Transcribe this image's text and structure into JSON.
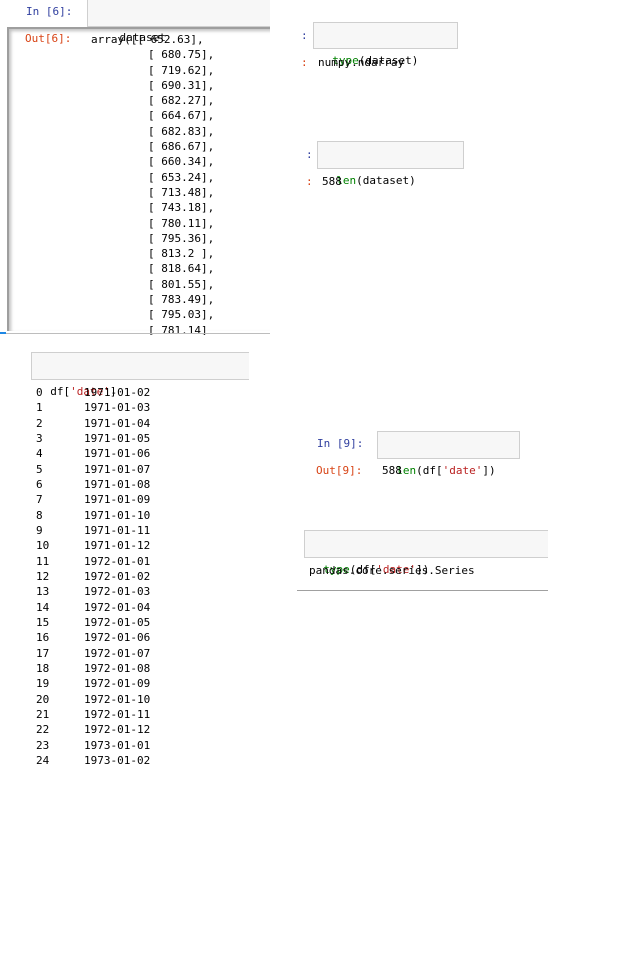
{
  "panel1": {
    "in_prompt": "In [6]:",
    "in_code": "dataset",
    "out_prompt": "Out[6]:",
    "array_first_line": "array([[ 652.63],",
    "array_lines": [
      "[ 680.75],",
      "[ 719.62],",
      "[ 690.31],",
      "[ 682.27],",
      "[ 664.67],",
      "[ 682.83],",
      "[ 686.67],",
      "[ 660.34],",
      "[ 653.24],",
      "[ 713.48],",
      "[ 743.18],",
      "[ 780.11],",
      "[ 795.36],",
      "[ 813.2 ],",
      "[ 818.64],",
      "[ 801.55],",
      "[ 783.49],",
      "[ 795.03],",
      "[ 781.14]"
    ]
  },
  "panel2": {
    "colon": ":",
    "code_func": "type",
    "code_arg": "(dataset)",
    "out_colon": ":",
    "output": "numpy.ndarray"
  },
  "panel2b": {
    "colon": ":",
    "code_func": "len",
    "code_arg": "(dataset)",
    "out_colon": ":",
    "output": "588"
  },
  "panel3": {
    "code_prefix": "df[",
    "code_string": "'date'",
    "code_suffix": "]",
    "rows": [
      {
        "index": "0",
        "value": "1971-01-02"
      },
      {
        "index": "1",
        "value": "1971-01-03"
      },
      {
        "index": "2",
        "value": "1971-01-04"
      },
      {
        "index": "3",
        "value": "1971-01-05"
      },
      {
        "index": "4",
        "value": "1971-01-06"
      },
      {
        "index": "5",
        "value": "1971-01-07"
      },
      {
        "index": "6",
        "value": "1971-01-08"
      },
      {
        "index": "7",
        "value": "1971-01-09"
      },
      {
        "index": "8",
        "value": "1971-01-10"
      },
      {
        "index": "9",
        "value": "1971-01-11"
      },
      {
        "index": "10",
        "value": "1971-01-12"
      },
      {
        "index": "11",
        "value": "1972-01-01"
      },
      {
        "index": "12",
        "value": "1972-01-02"
      },
      {
        "index": "13",
        "value": "1972-01-03"
      },
      {
        "index": "14",
        "value": "1972-01-04"
      },
      {
        "index": "15",
        "value": "1972-01-05"
      },
      {
        "index": "16",
        "value": "1972-01-06"
      },
      {
        "index": "17",
        "value": "1972-01-07"
      },
      {
        "index": "18",
        "value": "1972-01-08"
      },
      {
        "index": "19",
        "value": "1972-01-09"
      },
      {
        "index": "20",
        "value": "1972-01-10"
      },
      {
        "index": "21",
        "value": "1972-01-11"
      },
      {
        "index": "22",
        "value": "1972-01-12"
      },
      {
        "index": "23",
        "value": "1973-01-01"
      },
      {
        "index": "24",
        "value": "1973-01-02"
      }
    ]
  },
  "panel4": {
    "in_prompt": "In [9]:",
    "code_func": "len",
    "code_prefix": "(df[",
    "code_string": "'date'",
    "code_suffix": "])",
    "out_prompt": "Out[9]:",
    "output": "588"
  },
  "panel5": {
    "code_func": "type",
    "code_prefix": "(df[",
    "code_string": "'date'",
    "code_suffix": "])",
    "output": "pandas.core.series.Series"
  }
}
